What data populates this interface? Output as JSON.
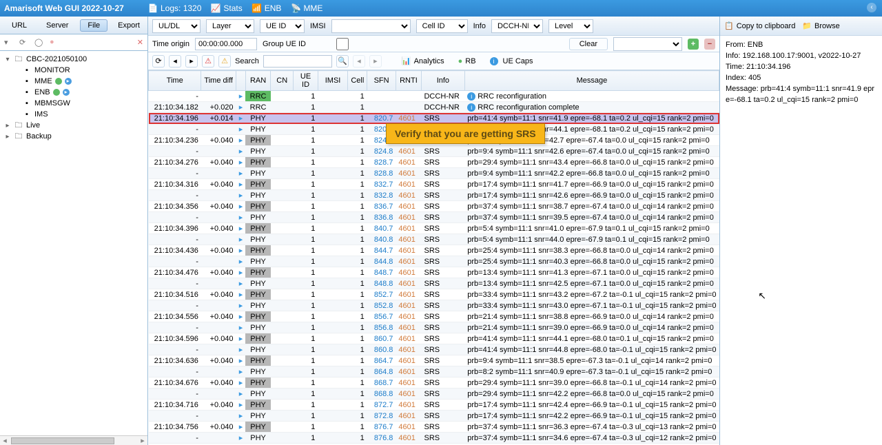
{
  "app": {
    "title": "Amarisoft Web GUI 2022-10-27"
  },
  "top_tabs": [
    {
      "icon": "📄",
      "label": "Logs: 1320"
    },
    {
      "icon": "📈",
      "label": "Stats"
    },
    {
      "icon": "📶",
      "label": "ENB"
    },
    {
      "icon": "📡",
      "label": "MME"
    }
  ],
  "left_toolbar": {
    "url": "URL",
    "server": "Server",
    "file": "File",
    "export": "Export"
  },
  "tree": {
    "root": "CBC-2021050100",
    "children": [
      {
        "label": "MONITOR"
      },
      {
        "label": "MME",
        "dots": true
      },
      {
        "label": "ENB",
        "dots": true
      },
      {
        "label": "MBMSGW"
      },
      {
        "label": "IMS"
      }
    ],
    "top": [
      {
        "label": "Live"
      },
      {
        "label": "Backup"
      }
    ]
  },
  "filters": {
    "uldl": "UL/DL",
    "layer": "Layer",
    "ueid": "UE ID",
    "imsi": "IMSI",
    "cellid": "Cell ID",
    "info_label": "Info",
    "info_val": "DCCH-NR.",
    "level": "Level"
  },
  "origin": {
    "label": "Time origin",
    "value": "00:00:00.000",
    "group": "Group UE ID",
    "clear": "Clear"
  },
  "search": {
    "label": "Search",
    "analytics": "Analytics",
    "rb": "RB",
    "uecaps": "UE Caps"
  },
  "columns": [
    "Time",
    "Time diff",
    "",
    "RAN",
    "CN",
    "UE ID",
    "IMSI",
    "Cell",
    "SFN",
    "RNTI",
    "Info",
    "Message"
  ],
  "callout": "Verify that you are getting SRS",
  "rows": [
    {
      "t": "-",
      "td": "",
      "ran": "RRC",
      "ue": "1",
      "cell": "1",
      "sfn": "",
      "rnti": "",
      "info": "DCCH-NR",
      "msg": "RRC reconfiguration",
      "msgico": true
    },
    {
      "t": "21:10:34.182",
      "td": "+0.020",
      "ran": "RRC",
      "ue": "1",
      "cell": "1",
      "sfn": "",
      "rnti": "",
      "info": "DCCH-NR",
      "msg": "RRC reconfiguration complete",
      "msgico": true
    },
    {
      "t": "21:10:34.196",
      "td": "+0.014",
      "ran": "PHY",
      "ue": "1",
      "cell": "1",
      "sfn": "820.7",
      "rnti": "4601",
      "info": "SRS",
      "msg": "prb=41:4 symb=11:1 snr=41.9 epre=-68.1 ta=0.2 ul_cqi=15 rank=2 pmi=0",
      "sel": true,
      "hl": true
    },
    {
      "t": "-",
      "td": "",
      "ran": "PHY",
      "ue": "1",
      "cell": "1",
      "sfn": "820.8",
      "rnti": "4601",
      "info": "SRS",
      "msg": "prb=41:4 symb=11:1 snr=44.1 epre=-68.1 ta=0.2 ul_cqi=15 rank=2 pmi=0"
    },
    {
      "t": "21:10:34.236",
      "td": "+0.040",
      "ran": "PHY",
      "ue": "1",
      "cell": "1",
      "sfn": "824.7",
      "rnti": "4601",
      "info": "SRS",
      "msg": "prb=9:4 symb=11:1 snr=42.7 epre=-67.4 ta=0.0 ul_cqi=15 rank=2 pmi=0"
    },
    {
      "t": "-",
      "td": "",
      "ran": "PHY",
      "ue": "1",
      "cell": "1",
      "sfn": "824.8",
      "rnti": "4601",
      "info": "SRS",
      "msg": "prb=9:4 symb=11:1 snr=42.6 epre=-67.4 ta=0.0 ul_cqi=15 rank=2 pmi=0"
    },
    {
      "t": "21:10:34.276",
      "td": "+0.040",
      "ran": "PHY",
      "ue": "1",
      "cell": "1",
      "sfn": "828.7",
      "rnti": "4601",
      "info": "SRS",
      "msg": "prb=29:4 symb=11:1 snr=43.4 epre=-66.8 ta=0.0 ul_cqi=15 rank=2 pmi=0"
    },
    {
      "t": "-",
      "td": "",
      "ran": "PHY",
      "ue": "1",
      "cell": "1",
      "sfn": "828.8",
      "rnti": "4601",
      "info": "SRS",
      "msg": "prb=9:4 symb=11:1 snr=42.2 epre=-66.8 ta=0.0 ul_cqi=15 rank=2 pmi=0"
    },
    {
      "t": "21:10:34.316",
      "td": "+0.040",
      "ran": "PHY",
      "ue": "1",
      "cell": "1",
      "sfn": "832.7",
      "rnti": "4601",
      "info": "SRS",
      "msg": "prb=17:4 symb=11:1 snr=41.7 epre=-66.9 ta=0.0 ul_cqi=15 rank=2 pmi=0"
    },
    {
      "t": "-",
      "td": "",
      "ran": "PHY",
      "ue": "1",
      "cell": "1",
      "sfn": "832.8",
      "rnti": "4601",
      "info": "SRS",
      "msg": "prb=17:4 symb=11:1 snr=42.6 epre=-66.9 ta=0.0 ul_cqi=15 rank=2 pmi=0"
    },
    {
      "t": "21:10:34.356",
      "td": "+0.040",
      "ran": "PHY",
      "ue": "1",
      "cell": "1",
      "sfn": "836.7",
      "rnti": "4601",
      "info": "SRS",
      "msg": "prb=37:4 symb=11:1 snr=38.7 epre=-67.4 ta=0.0 ul_cqi=14 rank=2 pmi=0"
    },
    {
      "t": "-",
      "td": "",
      "ran": "PHY",
      "ue": "1",
      "cell": "1",
      "sfn": "836.8",
      "rnti": "4601",
      "info": "SRS",
      "msg": "prb=37:4 symb=11:1 snr=39.5 epre=-67.4 ta=0.0 ul_cqi=14 rank=2 pmi=0"
    },
    {
      "t": "21:10:34.396",
      "td": "+0.040",
      "ran": "PHY",
      "ue": "1",
      "cell": "1",
      "sfn": "840.7",
      "rnti": "4601",
      "info": "SRS",
      "msg": "prb=5:4 symb=11:1 snr=41.0 epre=-67.9 ta=0.1 ul_cqi=15 rank=2 pmi=0"
    },
    {
      "t": "-",
      "td": "",
      "ran": "PHY",
      "ue": "1",
      "cell": "1",
      "sfn": "840.8",
      "rnti": "4601",
      "info": "SRS",
      "msg": "prb=5:4 symb=11:1 snr=44.0 epre=-67.9 ta=0.1 ul_cqi=15 rank=2 pmi=0"
    },
    {
      "t": "21:10:34.436",
      "td": "+0.040",
      "ran": "PHY",
      "ue": "1",
      "cell": "1",
      "sfn": "844.7",
      "rnti": "4601",
      "info": "SRS",
      "msg": "prb=25:4 symb=11:1 snr=38.3 epre=-66.8 ta=0.0 ul_cqi=14 rank=2 pmi=0"
    },
    {
      "t": "-",
      "td": "",
      "ran": "PHY",
      "ue": "1",
      "cell": "1",
      "sfn": "844.8",
      "rnti": "4601",
      "info": "SRS",
      "msg": "prb=25:4 symb=11:1 snr=40.3 epre=-66.8 ta=0.0 ul_cqi=15 rank=2 pmi=0"
    },
    {
      "t": "21:10:34.476",
      "td": "+0.040",
      "ran": "PHY",
      "ue": "1",
      "cell": "1",
      "sfn": "848.7",
      "rnti": "4601",
      "info": "SRS",
      "msg": "prb=13:4 symb=11:1 snr=41.3 epre=-67.1 ta=0.0 ul_cqi=15 rank=2 pmi=0"
    },
    {
      "t": "-",
      "td": "",
      "ran": "PHY",
      "ue": "1",
      "cell": "1",
      "sfn": "848.8",
      "rnti": "4601",
      "info": "SRS",
      "msg": "prb=13:4 symb=11:1 snr=42.5 epre=-67.1 ta=0.0 ul_cqi=15 rank=2 pmi=0"
    },
    {
      "t": "21:10:34.516",
      "td": "+0.040",
      "ran": "PHY",
      "ue": "1",
      "cell": "1",
      "sfn": "852.7",
      "rnti": "4601",
      "info": "SRS",
      "msg": "prb=33:4 symb=11:1 snr=43.2 epre=-67.2 ta=-0.1 ul_cqi=15 rank=2 pmi=0"
    },
    {
      "t": "-",
      "td": "",
      "ran": "PHY",
      "ue": "1",
      "cell": "1",
      "sfn": "852.8",
      "rnti": "4601",
      "info": "SRS",
      "msg": "prb=33:4 symb=11:1 snr=43.0 epre=-67.1 ta=-0.1 ul_cqi=15 rank=2 pmi=0"
    },
    {
      "t": "21:10:34.556",
      "td": "+0.040",
      "ran": "PHY",
      "ue": "1",
      "cell": "1",
      "sfn": "856.7",
      "rnti": "4601",
      "info": "SRS",
      "msg": "prb=21:4 symb=11:1 snr=38.8 epre=-66.9 ta=0.0 ul_cqi=14 rank=2 pmi=0"
    },
    {
      "t": "-",
      "td": "",
      "ran": "PHY",
      "ue": "1",
      "cell": "1",
      "sfn": "856.8",
      "rnti": "4601",
      "info": "SRS",
      "msg": "prb=21:4 symb=11:1 snr=39.0 epre=-66.9 ta=0.0 ul_cqi=14 rank=2 pmi=0"
    },
    {
      "t": "21:10:34.596",
      "td": "+0.040",
      "ran": "PHY",
      "ue": "1",
      "cell": "1",
      "sfn": "860.7",
      "rnti": "4601",
      "info": "SRS",
      "msg": "prb=41:4 symb=11:1 snr=44.1 epre=-68.0 ta=0.1 ul_cqi=15 rank=2 pmi=0"
    },
    {
      "t": "-",
      "td": "",
      "ran": "PHY",
      "ue": "1",
      "cell": "1",
      "sfn": "860.8",
      "rnti": "4601",
      "info": "SRS",
      "msg": "prb=41:4 symb=11:1 snr=44.8 epre=-68.0 ta=-0.1 ul_cqi=15 rank=2 pmi=0"
    },
    {
      "t": "21:10:34.636",
      "td": "+0.040",
      "ran": "PHY",
      "ue": "1",
      "cell": "1",
      "sfn": "864.7",
      "rnti": "4601",
      "info": "SRS",
      "msg": "prb=9:4 symb=11:1 snr=38.5 epre=-67.3 ta=-0.1 ul_cqi=14 rank=2 pmi=0"
    },
    {
      "t": "-",
      "td": "",
      "ran": "PHY",
      "ue": "1",
      "cell": "1",
      "sfn": "864.8",
      "rnti": "4601",
      "info": "SRS",
      "msg": "prb=8:2 symb=11:1 snr=40.9 epre=-67.3 ta=-0.1 ul_cqi=15 rank=2 pmi=0"
    },
    {
      "t": "21:10:34.676",
      "td": "+0.040",
      "ran": "PHY",
      "ue": "1",
      "cell": "1",
      "sfn": "868.7",
      "rnti": "4601",
      "info": "SRS",
      "msg": "prb=29:4 symb=11:1 snr=39.0 epre=-66.8 ta=-0.1 ul_cqi=14 rank=2 pmi=0"
    },
    {
      "t": "-",
      "td": "",
      "ran": "PHY",
      "ue": "1",
      "cell": "1",
      "sfn": "868.8",
      "rnti": "4601",
      "info": "SRS",
      "msg": "prb=29:4 symb=11:1 snr=42.2 epre=-66.8 ta=0.0 ul_cqi=15 rank=2 pmi=0"
    },
    {
      "t": "21:10:34.716",
      "td": "+0.040",
      "ran": "PHY",
      "ue": "1",
      "cell": "1",
      "sfn": "872.7",
      "rnti": "4601",
      "info": "SRS",
      "msg": "prb=17:4 symb=11:1 snr=42.4 epre=-66.9 ta=-0.1 ul_cqi=15 rank=2 pmi=0"
    },
    {
      "t": "-",
      "td": "",
      "ran": "PHY",
      "ue": "1",
      "cell": "1",
      "sfn": "872.8",
      "rnti": "4601",
      "info": "SRS",
      "msg": "prb=17:4 symb=11:1 snr=42.2 epre=-66.9 ta=-0.1 ul_cqi=15 rank=2 pmi=0"
    },
    {
      "t": "21:10:34.756",
      "td": "+0.040",
      "ran": "PHY",
      "ue": "1",
      "cell": "1",
      "sfn": "876.7",
      "rnti": "4601",
      "info": "SRS",
      "msg": "prb=37:4 symb=11:1 snr=36.3 epre=-67.4 ta=-0.3 ul_cqi=13 rank=2 pmi=0"
    },
    {
      "t": "-",
      "td": "",
      "ran": "PHY",
      "ue": "1",
      "cell": "1",
      "sfn": "876.8",
      "rnti": "4601",
      "info": "SRS",
      "msg": "prb=37:4 symb=11:1 snr=34.6 epre=-67.4 ta=-0.3 ul_cqi=12 rank=2 pmi=0"
    }
  ],
  "detail": {
    "from": "From: ENB",
    "info": "Info: 192.168.100.17:9001, v2022-10-27",
    "time": "Time: 21:10:34.196",
    "index": "Index: 405",
    "msg": "Message: prb=41:4 symb=11:1 snr=41.9 epre=-68.1 ta=0.2 ul_cqi=15 rank=2 pmi=0"
  },
  "right_toolbar": {
    "copy": "Copy to clipboard",
    "browse": "Browse"
  }
}
